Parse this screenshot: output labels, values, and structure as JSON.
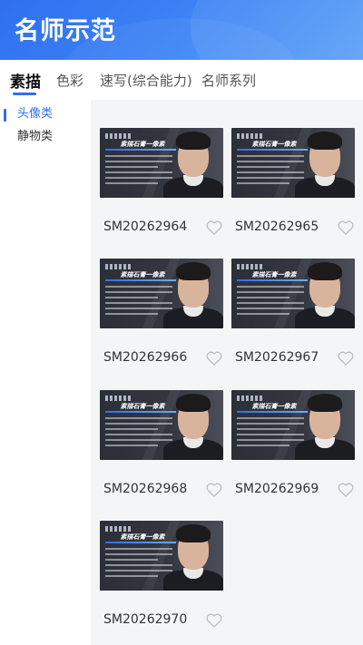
{
  "header": {
    "title": "名师示范",
    "gradient_start": "#2f6ff0",
    "gradient_end": "#5aa0f7"
  },
  "tabs": [
    {
      "label": "素描",
      "active": true
    },
    {
      "label": "色彩",
      "active": false
    },
    {
      "label": "速写(综合能力)",
      "active": false
    },
    {
      "label": "名师系列",
      "active": false
    }
  ],
  "sidebar": {
    "items": [
      {
        "label": "头像类",
        "active": true
      },
      {
        "label": "静物类",
        "active": false
      }
    ]
  },
  "accent_color": "#2f6ff0",
  "grid": {
    "items": [
      {
        "code": "SM20262964",
        "thumb_banner": "素描石膏一像素",
        "favorite_icon": "heart-outline-icon"
      },
      {
        "code": "SM20262965",
        "thumb_banner": "素描石膏一像素",
        "favorite_icon": "heart-outline-icon"
      },
      {
        "code": "SM20262966",
        "thumb_banner": "素描石膏一像素",
        "favorite_icon": "heart-outline-icon"
      },
      {
        "code": "SM20262967",
        "thumb_banner": "素描石膏一像素",
        "favorite_icon": "heart-outline-icon"
      },
      {
        "code": "SM20262968",
        "thumb_banner": "素描石膏一像素",
        "favorite_icon": "heart-outline-icon"
      },
      {
        "code": "SM20262969",
        "thumb_banner": "素描石膏一像素",
        "favorite_icon": "heart-outline-icon"
      },
      {
        "code": "SM20262970",
        "thumb_banner": "素描石膏一像素",
        "favorite_icon": "heart-outline-icon"
      }
    ]
  }
}
